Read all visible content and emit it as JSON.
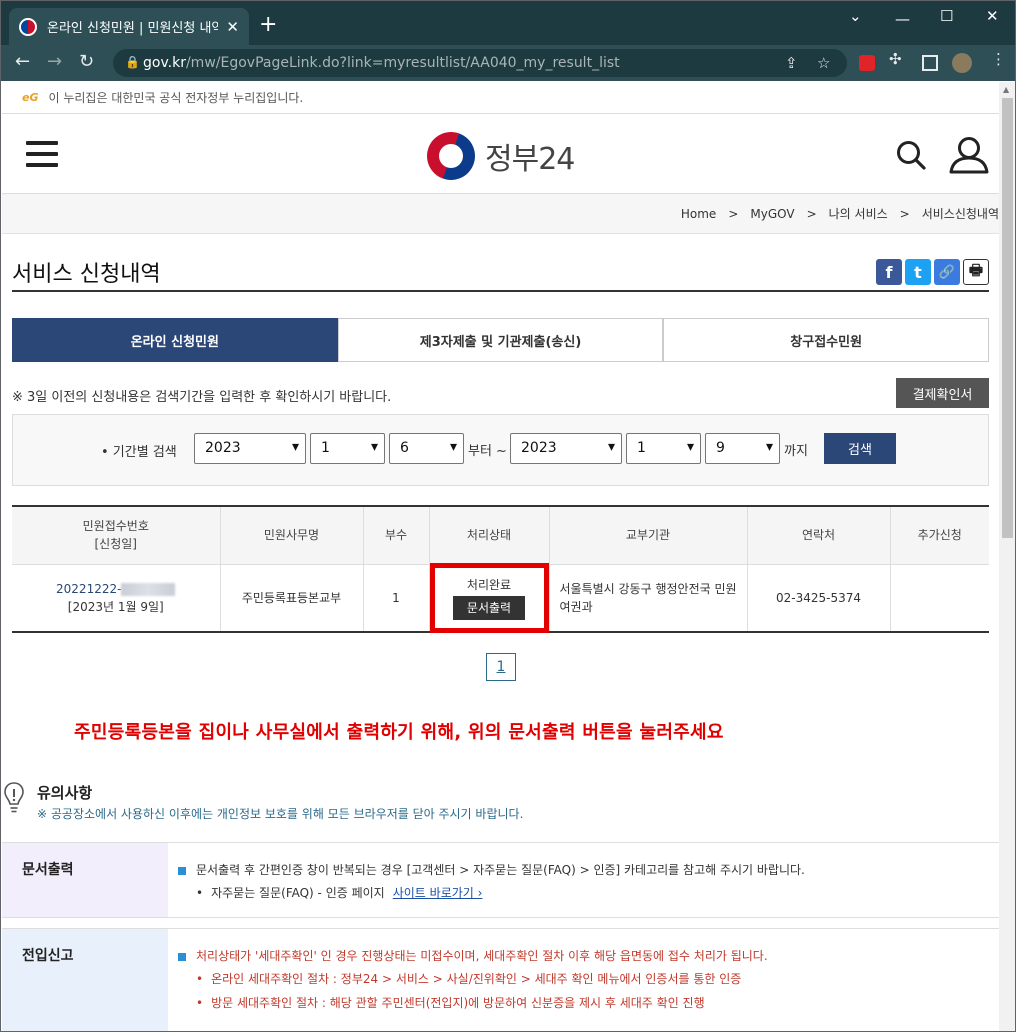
{
  "browser": {
    "tab_title": "온라인 신청민원 | 민원신청 내역",
    "tab_close": "✕",
    "new_tab": "+",
    "url_host": "gov.kr",
    "url_path": "/mw/EgovPageLink.do?link=myresultlist/AA040_my_result_list",
    "icons": [
      "back-icon",
      "forward-icon",
      "reload-icon",
      "lock-icon",
      "share-icon",
      "star-icon",
      "extension-icon",
      "puzzle-icon",
      "sidepanel-icon",
      "profile-icon",
      "menu-icon"
    ]
  },
  "site": {
    "notice": "이 누리집은 대한민국 공식 전자정부 누리집입니다.",
    "eg_logo": "eG",
    "logo_text": "정부24"
  },
  "breadcrumb": [
    "Home",
    "MyGOV",
    "나의 서비스",
    "서비스신청내역"
  ],
  "breadcrumb_sep": ">",
  "page_title": "서비스 신청내역",
  "share": {
    "facebook": "f",
    "twitter": "t",
    "link": "🔗",
    "print": "🖶"
  },
  "tabs": [
    "온라인 신청민원",
    "제3자제출 및 기관제출(송신)",
    "창구접수민원"
  ],
  "active_tab": 0,
  "note": "※ 3일 이전의 신청내용은 검색기간을 입력한 후 확인하시기 바랍니다.",
  "receipt_button": "결제확인서",
  "search": {
    "label": "• 기간별 검색",
    "from_year": "2023",
    "from_month": "1",
    "from_day": "6",
    "from_suffix": "부터 ~",
    "to_year": "2023",
    "to_month": "1",
    "to_day": "9",
    "to_suffix": "까지",
    "button": "검색"
  },
  "table": {
    "headers": [
      "민원접수번호\n[신청일]",
      "민원사무명",
      "부수",
      "처리상태",
      "교부기관",
      "연락처",
      "추가신청"
    ],
    "rows": [
      {
        "receipt_no": "20221222-",
        "date": "[2023년 1월 9일]",
        "service": "주민등록표등본교부",
        "copies": "1",
        "status": "처리완료",
        "action": "문서출력",
        "org": "서울특별시 강동구 행정안전국 민원여권과",
        "contact": "02-3425-5374",
        "extra": ""
      }
    ]
  },
  "pager": "1",
  "red_message": "주민등록등본을 집이나 사무실에서 출력하기 위해, 위의 문서출력 버튼을 눌러주세요",
  "caution": {
    "title": "유의사항",
    "text": "※ 공공장소에서 사용하신 이후에는 개인정보 보호를 위해 모든 브라우저를 닫아 주시기 바랍니다."
  },
  "info_print": {
    "head": "문서출력",
    "line1": "문서출력 후 간편인증 창이 반복되는 경우 [고객센터 > 자주묻는 질문(FAQ) > 인증] 카테고리를 참고해 주시기 바랍니다.",
    "line2": "자주묻는 질문(FAQ) - 인증 페이지",
    "link": "사이트 바로가기 ›"
  },
  "info_move": {
    "head": "전입신고",
    "line1": "처리상태가 '세대주확인' 인 경우 진행상태는 미접수이며, 세대주확인 절차 이후 해당 읍면동에 접수 처리가 됩니다.",
    "line2": "온라인 세대주확인 절차 : 정부24 > 서비스 > 사실/진위확인 > 세대주 확인 메뉴에서 인증서를 통한 인증",
    "line3": "방문 세대주확인 절차 : 해당 관할 주민센터(전입지)에 방문하여 신분증을 제시 후 세대주 확인 진행"
  },
  "colors": {
    "primary": "#2b4778",
    "highlight_box": "#e30000",
    "red_message": "#e00000",
    "print_head_bg": "#f3eefc",
    "move_head_bg": "#e8f1fb"
  }
}
